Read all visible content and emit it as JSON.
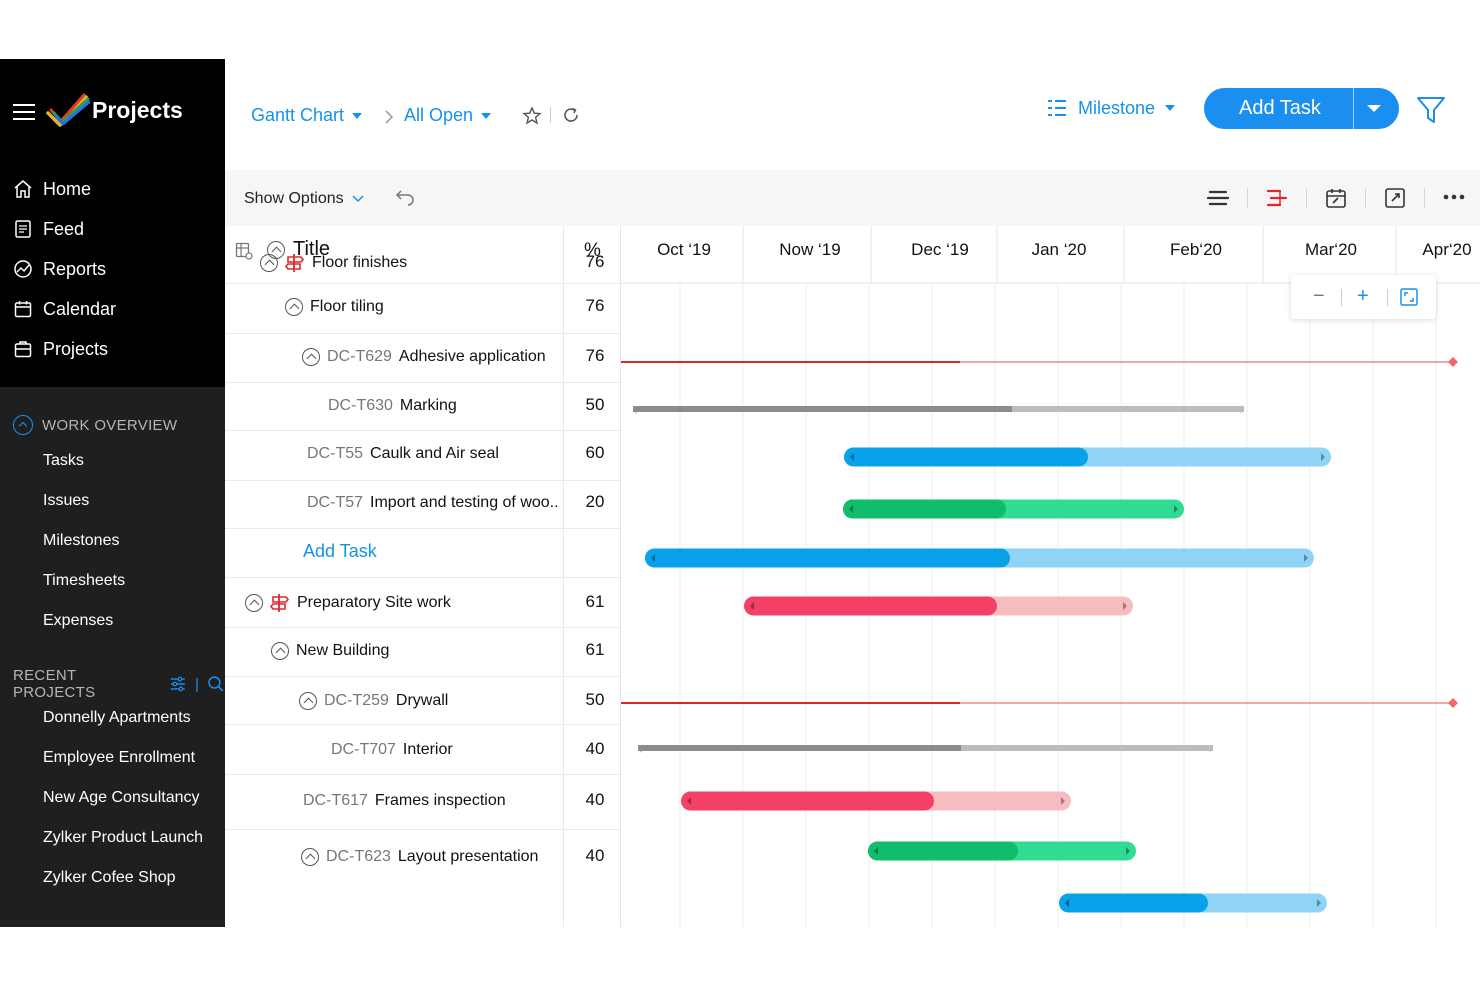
{
  "app": {
    "name": "Projects"
  },
  "sidebar": {
    "nav": [
      {
        "label": "Home",
        "icon": "home-icon"
      },
      {
        "label": "Feed",
        "icon": "feed-icon"
      },
      {
        "label": "Reports",
        "icon": "reports-icon"
      },
      {
        "label": "Calendar",
        "icon": "calendar-icon"
      },
      {
        "label": "Projects",
        "icon": "projects-icon"
      }
    ],
    "work_overview": {
      "title": "WORK OVERVIEW",
      "items": [
        "Tasks",
        "Issues",
        "Milestones",
        "Timesheets",
        "Expenses"
      ]
    },
    "recent_projects": {
      "title": "RECENT PROJECTS",
      "items": [
        "Donnelly Apartments",
        "Employee Enrollment",
        "New Age Consultancy",
        "Zylker Product Launch",
        "Zylker Cofee Shop"
      ]
    }
  },
  "header": {
    "breadcrumb": [
      "Gantt Chart",
      "All Open"
    ],
    "milestone_label": "Milestone",
    "add_task_label": "Add Task"
  },
  "toolbar": {
    "show_options": "Show Options"
  },
  "table": {
    "title_header": "Title",
    "percent_header": "%",
    "add_task_link": "Add Task",
    "rows": [
      {
        "id": "",
        "name": "Floor finishes",
        "pct": "76",
        "type": "milestone"
      },
      {
        "id": "",
        "name": "Floor tiling",
        "pct": "76",
        "type": "group"
      },
      {
        "id": "DC-T629",
        "name": "Adhesive application",
        "pct": "76",
        "type": "task"
      },
      {
        "id": "DC-T630",
        "name": "Marking",
        "pct": "50",
        "type": "task"
      },
      {
        "id": "DC-T55",
        "name": "Caulk and Air seal",
        "pct": "60",
        "type": "task"
      },
      {
        "id": "DC-T57",
        "name": "Import and testing of woo..",
        "pct": "20",
        "type": "task"
      },
      {
        "id": "",
        "name": "Preparatory Site work",
        "pct": "61",
        "type": "milestone"
      },
      {
        "id": "",
        "name": "New Building",
        "pct": "61",
        "type": "group"
      },
      {
        "id": "DC-T259",
        "name": "Drywall",
        "pct": "50",
        "type": "task"
      },
      {
        "id": "DC-T707",
        "name": "Interior",
        "pct": "40",
        "type": "task"
      },
      {
        "id": "DC-T617",
        "name": "Frames inspection",
        "pct": "40",
        "type": "task"
      },
      {
        "id": "DC-T623",
        "name": "Layout presentation",
        "pct": "40",
        "type": "task"
      }
    ]
  },
  "timeline": {
    "months": [
      "Oct ‘19",
      "Now ‘19",
      "Dec ‘19",
      "Jan ‘20",
      "Feb‘20",
      "Mar‘20",
      "Apr‘20"
    ]
  },
  "colors": {
    "accent": "#1a8ff0",
    "milestone_red": "#e0262b",
    "blue": "#08a1ea",
    "blue_light": "#8fd3f6",
    "green": "#10bd6a",
    "green_light": "#2fdc92",
    "pink": "#f43f66",
    "pink_light": "#f6bcc0",
    "gray": "#8c8c8c",
    "gray_light": "#bdbdbd"
  }
}
